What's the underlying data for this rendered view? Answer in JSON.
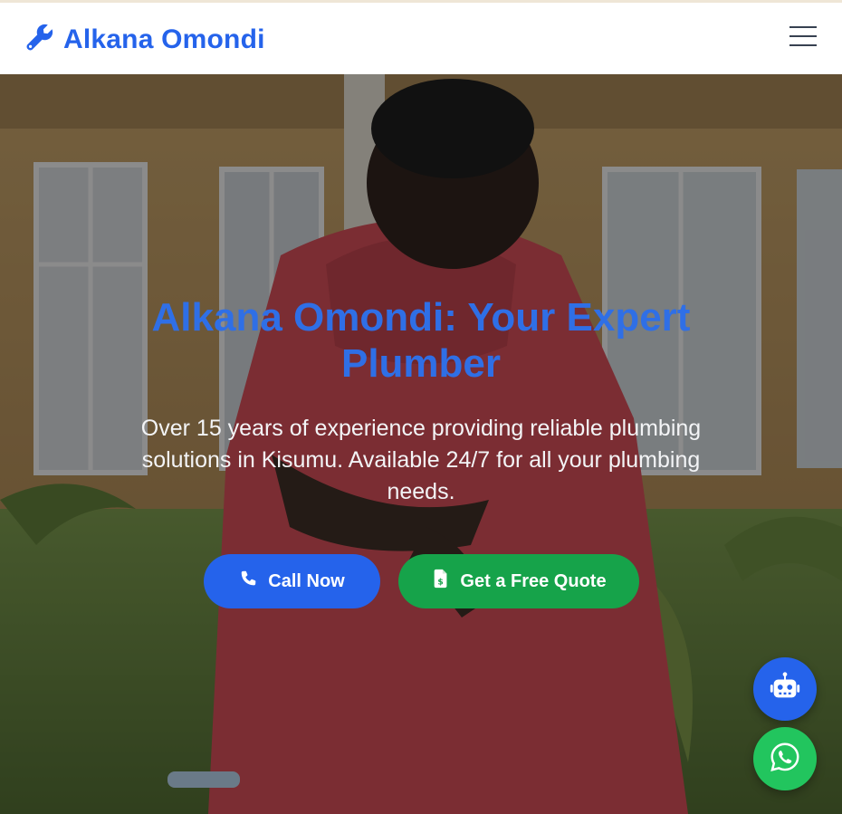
{
  "brand": {
    "name": "Alkana Omondi",
    "icon": "wrench-icon"
  },
  "nav": {
    "menu_icon": "hamburger-menu-icon"
  },
  "hero": {
    "title": "Alkana Omondi: Your Expert Plumber",
    "subtitle": "Over 15 years of experience providing reliable plumbing solutions in Kisumu. Available 24/7 for all your plumbing needs.",
    "primary_button": {
      "label": "Call Now",
      "icon": "phone-icon"
    },
    "secondary_button": {
      "label": "Get a Free Quote",
      "icon": "invoice-dollar-icon"
    }
  },
  "floating": {
    "chatbot_icon": "robot-icon",
    "whatsapp_icon": "whatsapp-icon"
  },
  "colors": {
    "brand": "#2563eb",
    "call_button": "#2563eb",
    "quote_button": "#16a34a",
    "whatsapp": "#22c55e",
    "hero_title": "#2f6fe6"
  }
}
